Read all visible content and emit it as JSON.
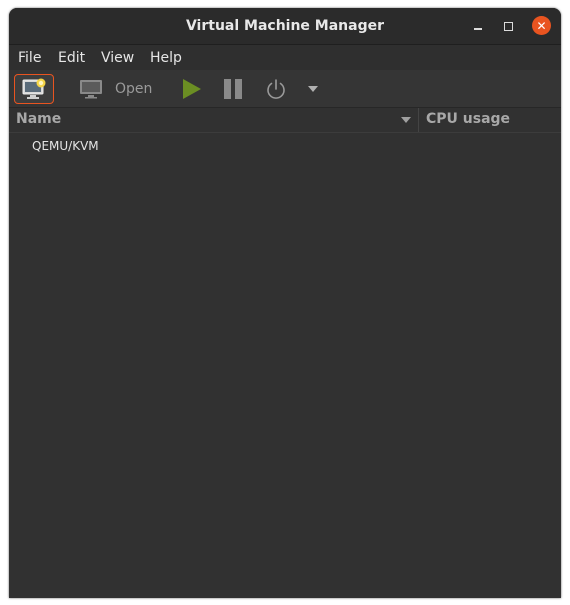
{
  "window": {
    "title": "Virtual Machine Manager",
    "accent_color": "#e95420"
  },
  "titlebar_buttons": {
    "minimize_icon": "minimize-icon",
    "maximize_icon": "maximize-icon",
    "close_icon": "close-icon",
    "close_glyph": "✕"
  },
  "menubar": {
    "items": [
      {
        "label": "File"
      },
      {
        "label": "Edit"
      },
      {
        "label": "View"
      },
      {
        "label": "Help"
      }
    ]
  },
  "toolbar": {
    "new_vm_icon": "new-vm-icon",
    "open_label": "Open",
    "open_icon": "monitor-icon",
    "run_icon": "play-icon",
    "pause_icon": "pause-icon",
    "shutdown_icon": "power-icon",
    "shutdown_menu_icon": "chevron-down-icon",
    "run_color": "#6b8e23"
  },
  "columns": {
    "name": "Name",
    "cpu": "CPU usage"
  },
  "connections": [
    {
      "label": "QEMU/KVM"
    }
  ]
}
